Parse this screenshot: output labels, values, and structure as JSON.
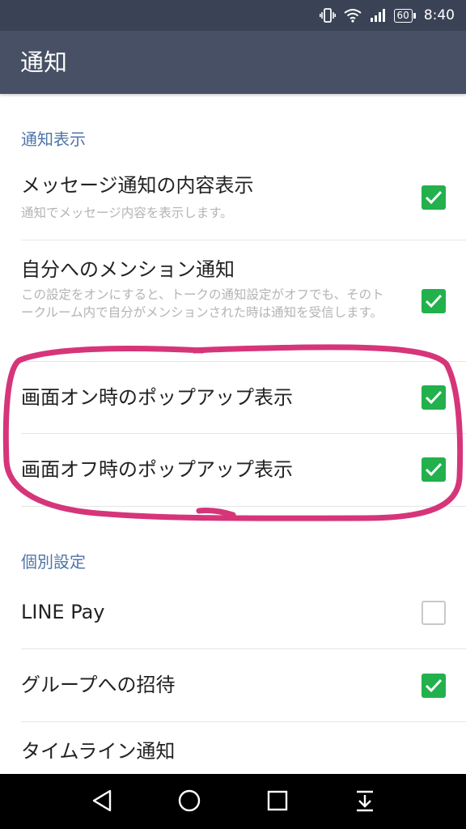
{
  "status_bar": {
    "battery": "60",
    "time": "8:40"
  },
  "app_bar": {
    "title": "通知"
  },
  "sections": [
    {
      "header": "通知表示",
      "items": [
        {
          "title": "メッセージ通知の内容表示",
          "subtitle": "通知でメッセージ内容を表示します。",
          "checked": true
        },
        {
          "title": "自分へのメンション通知",
          "subtitle": "この設定をオンにすると、トークの通知設定がオフでも、そのトークルーム内で自分がメンションされた時は通知を受信します。",
          "checked": true
        },
        {
          "title": "画面オン時のポップアップ表示",
          "checked": true
        },
        {
          "title": "画面オフ時のポップアップ表示",
          "checked": true
        }
      ]
    },
    {
      "header": "個別設定",
      "items": [
        {
          "title": "LINE Pay",
          "checked": false
        },
        {
          "title": "グループへの招待",
          "checked": true
        },
        {
          "title": "タイムライン通知",
          "checked": null
        }
      ]
    }
  ],
  "colors": {
    "status_bar": "#3a4356",
    "app_bar": "#475064",
    "section_header": "#4f75a8",
    "checkbox_on": "#22b14c",
    "annotation": "#d6357a"
  },
  "icons": {
    "status": [
      "vibrate-icon",
      "wifi-icon",
      "signal-icon",
      "battery-icon"
    ],
    "nav": [
      "back-icon",
      "home-icon",
      "recents-icon",
      "notification-pull-icon"
    ]
  }
}
